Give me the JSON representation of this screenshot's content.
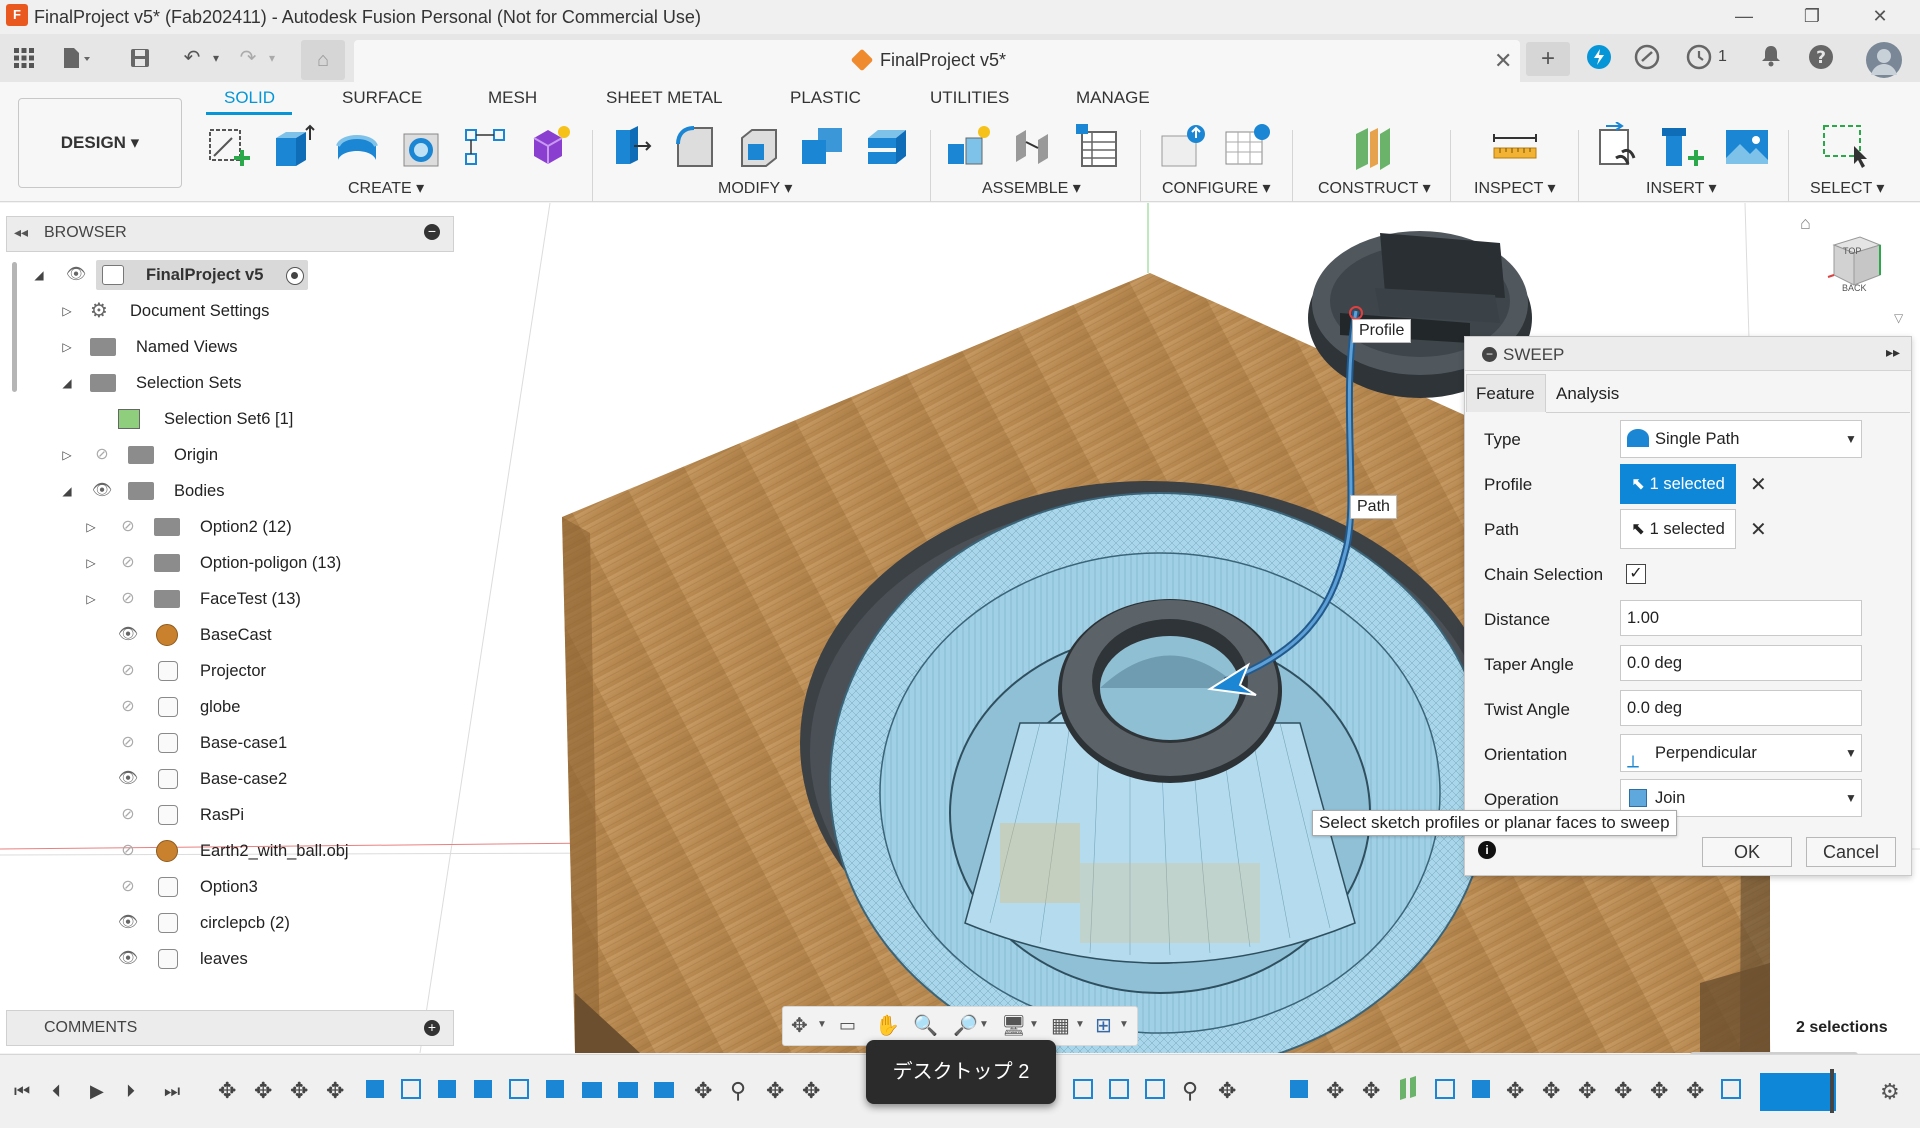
{
  "window": {
    "title": "FinalProject v5* (Fab202411) - Autodesk Fusion Personal (Not for Commercial Use)",
    "logo_letter": "F"
  },
  "doc_tab": {
    "title": "FinalProject v5*",
    "job_count": "1"
  },
  "workspace_tabs": [
    "SOLID",
    "SURFACE",
    "MESH",
    "SHEET METAL",
    "PLASTIC",
    "UTILITIES",
    "MANAGE"
  ],
  "design_button": "DESIGN ▾",
  "tool_groups": [
    "CREATE ▾",
    "MODIFY ▾",
    "ASSEMBLE ▾",
    "CONFIGURE ▾",
    "CONSTRUCT ▾",
    "INSPECT ▾",
    "INSERT ▾",
    "SELECT ▾"
  ],
  "browser": {
    "title": "BROWSER",
    "root": "FinalProject v5",
    "rows": [
      {
        "label": "Document Settings",
        "kind": "settings"
      },
      {
        "label": "Named Views",
        "kind": "folder"
      },
      {
        "label": "Selection Sets",
        "kind": "folder"
      },
      {
        "label": "Selection Set6 [1]",
        "kind": "set"
      },
      {
        "label": "Origin",
        "kind": "folder"
      },
      {
        "label": "Bodies",
        "kind": "folder"
      },
      {
        "label": "Option2 (12)",
        "kind": "folder"
      },
      {
        "label": "Option-poligon (13)",
        "kind": "folder"
      },
      {
        "label": "FaceTest (13)",
        "kind": "folder"
      },
      {
        "label": "BaseCast",
        "kind": "mesh"
      },
      {
        "label": "Projector",
        "kind": "body"
      },
      {
        "label": "globe",
        "kind": "body"
      },
      {
        "label": "Base-case1",
        "kind": "body"
      },
      {
        "label": "Base-case2",
        "kind": "body"
      },
      {
        "label": "RasPi",
        "kind": "body"
      },
      {
        "label": "Earth2_with_ball.obj",
        "kind": "mesh"
      },
      {
        "label": "Option3",
        "kind": "body"
      },
      {
        "label": "circlepcb (2)",
        "kind": "body"
      },
      {
        "label": "leaves",
        "kind": "body"
      }
    ]
  },
  "comments": {
    "title": "COMMENTS"
  },
  "viewcube": {
    "top": "TOP",
    "back": "BACK"
  },
  "canvas_labels": {
    "profile": "Profile",
    "path": "Path"
  },
  "sweep": {
    "title": "SWEEP",
    "tabs": [
      "Feature",
      "Analysis"
    ],
    "type_label": "Type",
    "type_value": "Single Path",
    "profile_label": "Profile",
    "profile_value": "1 selected",
    "path_label": "Path",
    "path_value": "1 selected",
    "chain_label": "Chain Selection",
    "chain_checked": true,
    "distance_label": "Distance",
    "distance_value": "1.00",
    "taper_label": "Taper Angle",
    "taper_value": "0.0 deg",
    "twist_label": "Twist Angle",
    "twist_value": "0.0 deg",
    "orientation_label": "Orientation",
    "orientation_value": "Perpendicular",
    "operation_label": "Operation",
    "operation_value": "Join",
    "tooltip": "Select sketch profiles or planar faces to sweep",
    "ok": "OK",
    "cancel": "Cancel"
  },
  "status": {
    "selections": "2 selections"
  },
  "toast": "デスクトップ 2",
  "colors": {
    "accent": "#0696d7",
    "selected_button": "#0f87d8",
    "wood": "#b98a55",
    "mesh_blue": "#a9d6ea"
  }
}
